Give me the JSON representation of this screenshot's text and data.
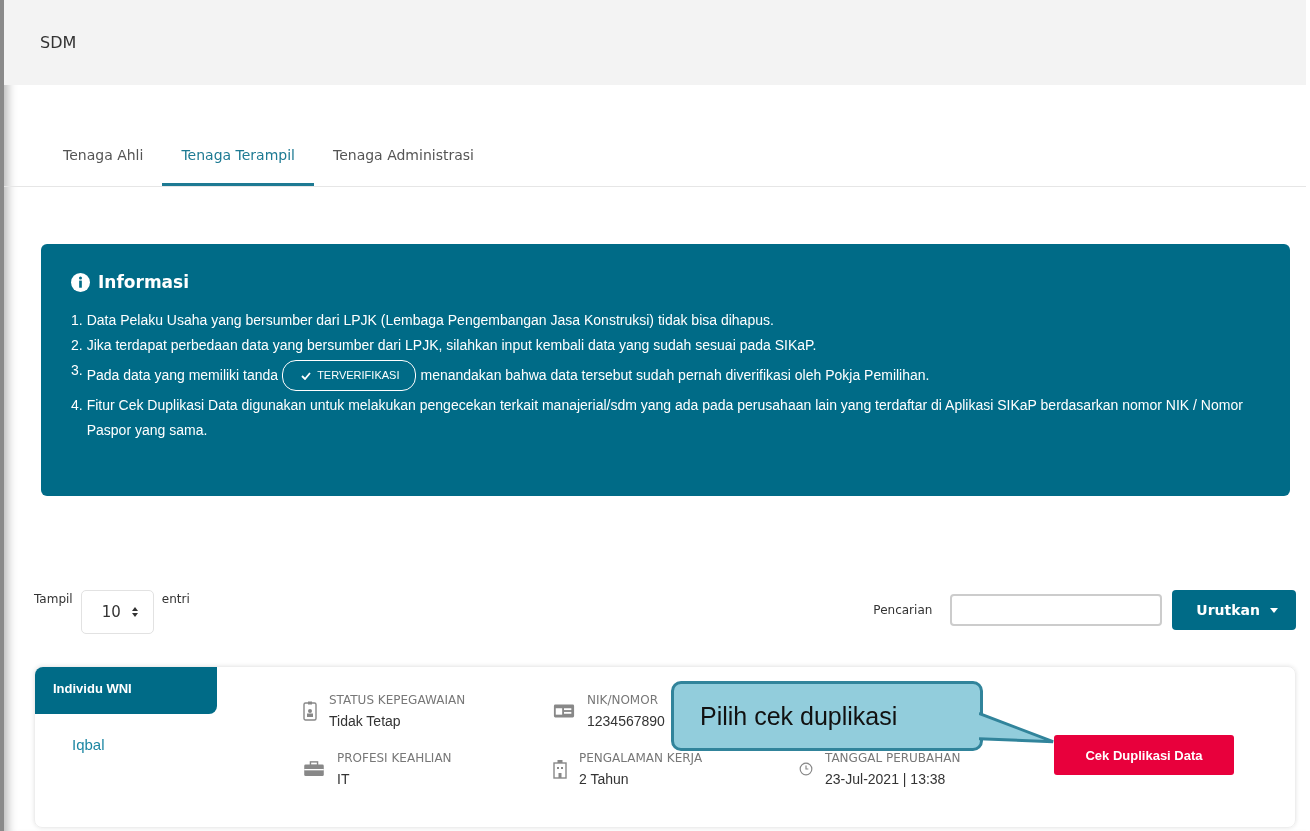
{
  "header": {
    "title": "SDM"
  },
  "tabs": [
    {
      "label": "Tenaga Ahli",
      "selected": false
    },
    {
      "label": "Tenaga Terampil",
      "selected": true
    },
    {
      "label": "Tenaga Administrasi",
      "selected": false
    }
  ],
  "info": {
    "title": "Informasi",
    "items": [
      {
        "kind": "text",
        "number": "1.",
        "text": "Data Pelaku Usaha yang bersumber dari LPJK (Lembaga Pengembangan Jasa Konstruksi) tidak bisa dihapus."
      },
      {
        "kind": "text",
        "number": "2.",
        "text": "Jika terdapat perbedaan data yang bersumber dari LPJK, silahkan input kembali data yang sudah sesuai pada SIKaP."
      },
      {
        "kind": "badge",
        "number": "3.",
        "before": "Pada data yang memiliki tanda",
        "badge": "TERVERIFIKASI",
        "after": "menandakan bahwa data tersebut sudah pernah diverifikasi oleh Pokja Pemilihan."
      },
      {
        "kind": "text",
        "number": "4.",
        "text": "Fitur Cek Duplikasi Data digunakan untuk melakukan pengecekan terkait manajerial/sdm yang ada pada perusahaan lain yang terdaftar di Aplikasi SIKaP berdasarkan nomor NIK / Nomor Paspor yang sama."
      }
    ]
  },
  "controls": {
    "show_label": "Tampil",
    "page_size": "10",
    "entries_label": "entri",
    "search_label": "Pencarian",
    "sort_button": "Urutkan"
  },
  "record": {
    "type": "Individu WNI",
    "name": "Iqbal",
    "fields": [
      {
        "label": "STATUS KEPEGAWAIAN",
        "value": "Tidak Tetap"
      },
      {
        "label": "NIK/NOMOR",
        "value": "1234567890"
      },
      {
        "label": "PROFESI KEAHLIAN",
        "value": "IT"
      },
      {
        "label": "PENGALAMAN KERJA",
        "value": "2 Tahun"
      },
      {
        "label": "TANGGAL PERUBAHAN",
        "value": "23-Jul-2021 | 13:38"
      }
    ],
    "action": "Cek Duplikasi Data"
  },
  "callout": {
    "text": "Pilih cek duplikasi"
  }
}
